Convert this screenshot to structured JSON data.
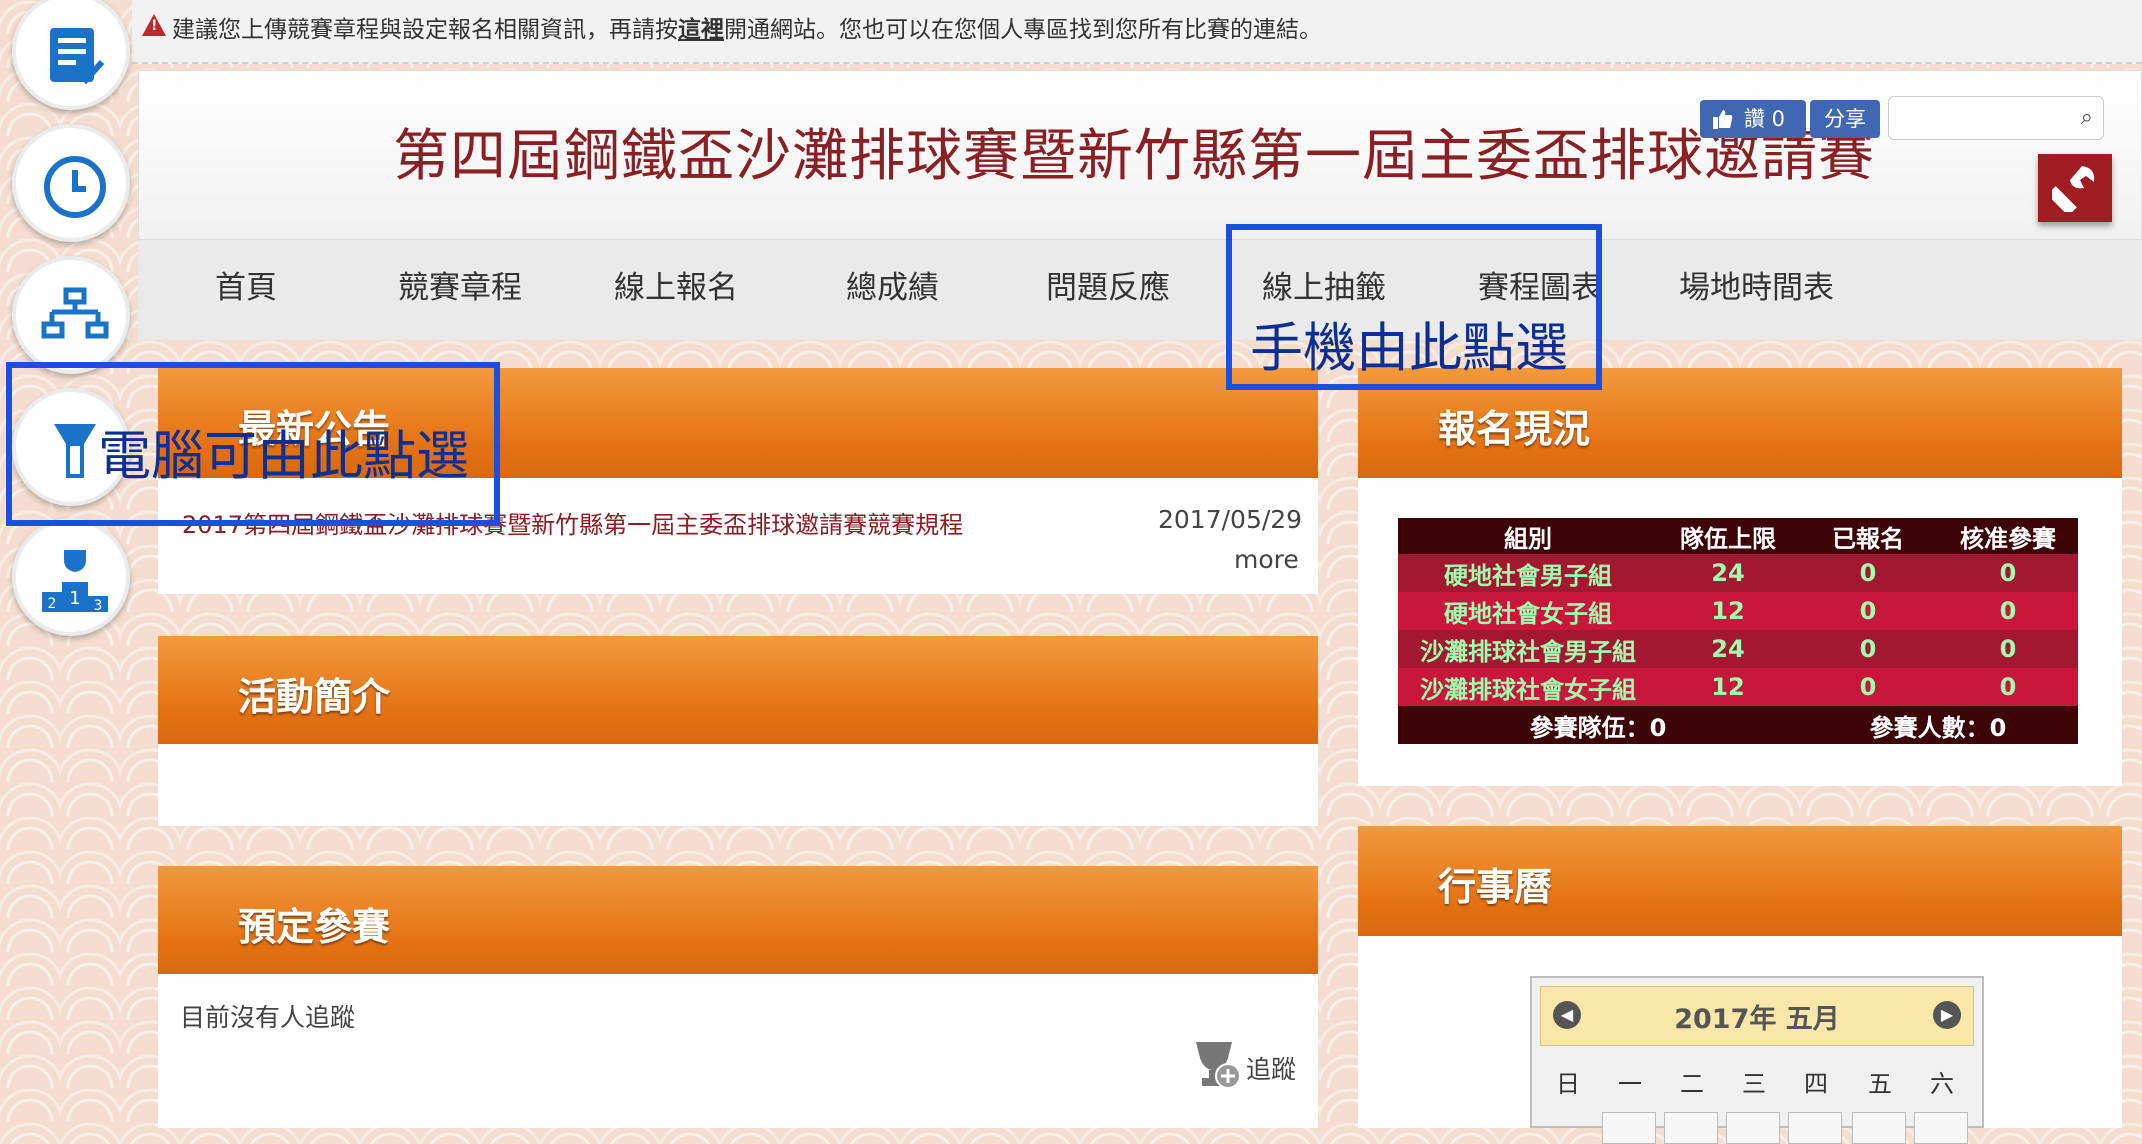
{
  "notice": {
    "icon": "warning-icon",
    "text_before": "建議您上傳競賽章程與設定報名相關資訊，再請按",
    "link": "這裡",
    "text_after": "開通網站。您也可以在您個人專區找到您所有比賽的連結。"
  },
  "rail": [
    "schedule-list-icon",
    "clock-icon",
    "bracket-icon",
    "tools-icon",
    "podium-icon"
  ],
  "header": {
    "title": "第四屆鋼鐵盃沙灘排球賽暨新竹縣第一屆主委盃排球邀請賽",
    "fb_like_label": "讚 0",
    "fb_share_label": "分享",
    "search_placeholder": ""
  },
  "nav": [
    "首頁",
    "競賽章程",
    "線上報名",
    "總成績",
    "問題反應",
    "線上抽籤",
    "賽程圖表",
    "場地時間表"
  ],
  "news": {
    "title": "最新公告",
    "item_title": "2017第四屆鋼鐵盃沙灘排球賽暨新竹縣第一屆主委盃排球邀請賽競賽規程",
    "item_date": "2017/05/29",
    "more": "more"
  },
  "intro": {
    "title": "活動簡介"
  },
  "follow": {
    "title": "預定參賽",
    "empty_text": "目前沒有人追蹤",
    "follow_label": "追蹤"
  },
  "registration": {
    "title": "報名現況",
    "headers": [
      "組別",
      "隊伍上限",
      "已報名",
      "核准參賽"
    ],
    "rows": [
      [
        "硬地社會男子組",
        "24",
        "0",
        "0"
      ],
      [
        "硬地社會女子組",
        "12",
        "0",
        "0"
      ],
      [
        "沙灘排球社會男子組",
        "24",
        "0",
        "0"
      ],
      [
        "沙灘排球社會女子組",
        "12",
        "0",
        "0"
      ]
    ],
    "total_teams": "參賽隊伍：0",
    "total_players": "參賽人數：0"
  },
  "calendar": {
    "title": "行事曆",
    "month_label": "2017年 五月",
    "weekdays": [
      "日",
      "一",
      "二",
      "三",
      "四",
      "五",
      "六"
    ]
  },
  "annotations": {
    "mobile": "手機由此點選",
    "desktop": "電腦可由此點選",
    "box_color": "#1b4fe0",
    "text_color": "#0c2f93"
  },
  "colors": {
    "accent_orange": "#e47214",
    "title_red": "#8a1f24",
    "facebook_blue": "#4267b2"
  }
}
